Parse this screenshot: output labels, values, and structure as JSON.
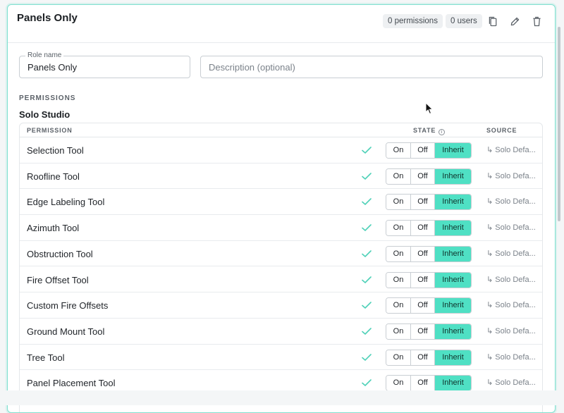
{
  "role": {
    "title": "Panels Only",
    "permissions_count": "0 permissions",
    "users_count": "0 users"
  },
  "icons": {
    "copy": "copy-icon",
    "edit": "pencil-icon",
    "delete": "trash-icon"
  },
  "form": {
    "role_name_label": "Role name",
    "role_name_value": "Panels Only",
    "description_placeholder": "Description (optional)"
  },
  "permissions_section": {
    "label": "PERMISSIONS",
    "group_title": "Solo Studio",
    "columns": {
      "permission": "PERMISSION",
      "state": "STATE",
      "source": "SOURCE"
    },
    "state_options": [
      "On",
      "Off",
      "Inherit"
    ],
    "selected_state": "Inherit",
    "rows": [
      {
        "name": "Selection Tool",
        "source": "↳ Solo Defa..."
      },
      {
        "name": "Roofline Tool",
        "source": "↳ Solo Defa..."
      },
      {
        "name": "Edge Labeling Tool",
        "source": "↳ Solo Defa..."
      },
      {
        "name": "Azimuth Tool",
        "source": "↳ Solo Defa..."
      },
      {
        "name": "Obstruction Tool",
        "source": "↳ Solo Defa..."
      },
      {
        "name": "Fire Offset Tool",
        "source": "↳ Solo Defa..."
      },
      {
        "name": "Custom Fire Offsets",
        "source": "↳ Solo Defa..."
      },
      {
        "name": "Ground Mount Tool",
        "source": "↳ Solo Defa..."
      },
      {
        "name": "Tree Tool",
        "source": "↳ Solo Defa..."
      },
      {
        "name": "Panel Placement Tool",
        "source": "↳ Solo Defa..."
      }
    ]
  },
  "colors": {
    "accent": "#4fe0c4",
    "check": "#4fd1b8",
    "card_border": "#7fe0cf"
  }
}
